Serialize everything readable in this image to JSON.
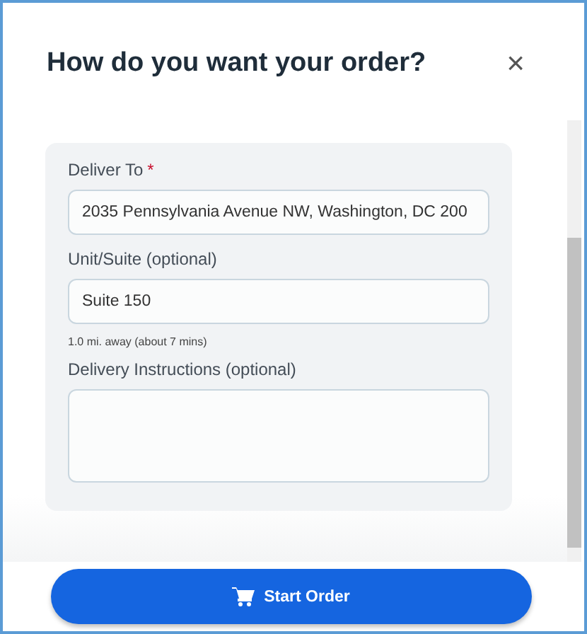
{
  "dialog": {
    "title": "How do you want your order?",
    "close": "×"
  },
  "fields": [
    {
      "kind": "input",
      "label": "Deliver To",
      "required_mark": "*",
      "value": "2035 Pennsylvania Avenue NW, Washington, DC 200"
    },
    {
      "kind": "input",
      "label": "Unit/Suite (optional)",
      "value": "Suite 150",
      "note": "1.0 mi. away (about 7 mins)"
    },
    {
      "kind": "textarea",
      "label": "Delivery Instructions (optional)"
    }
  ],
  "button": {
    "label": "Start Order"
  }
}
